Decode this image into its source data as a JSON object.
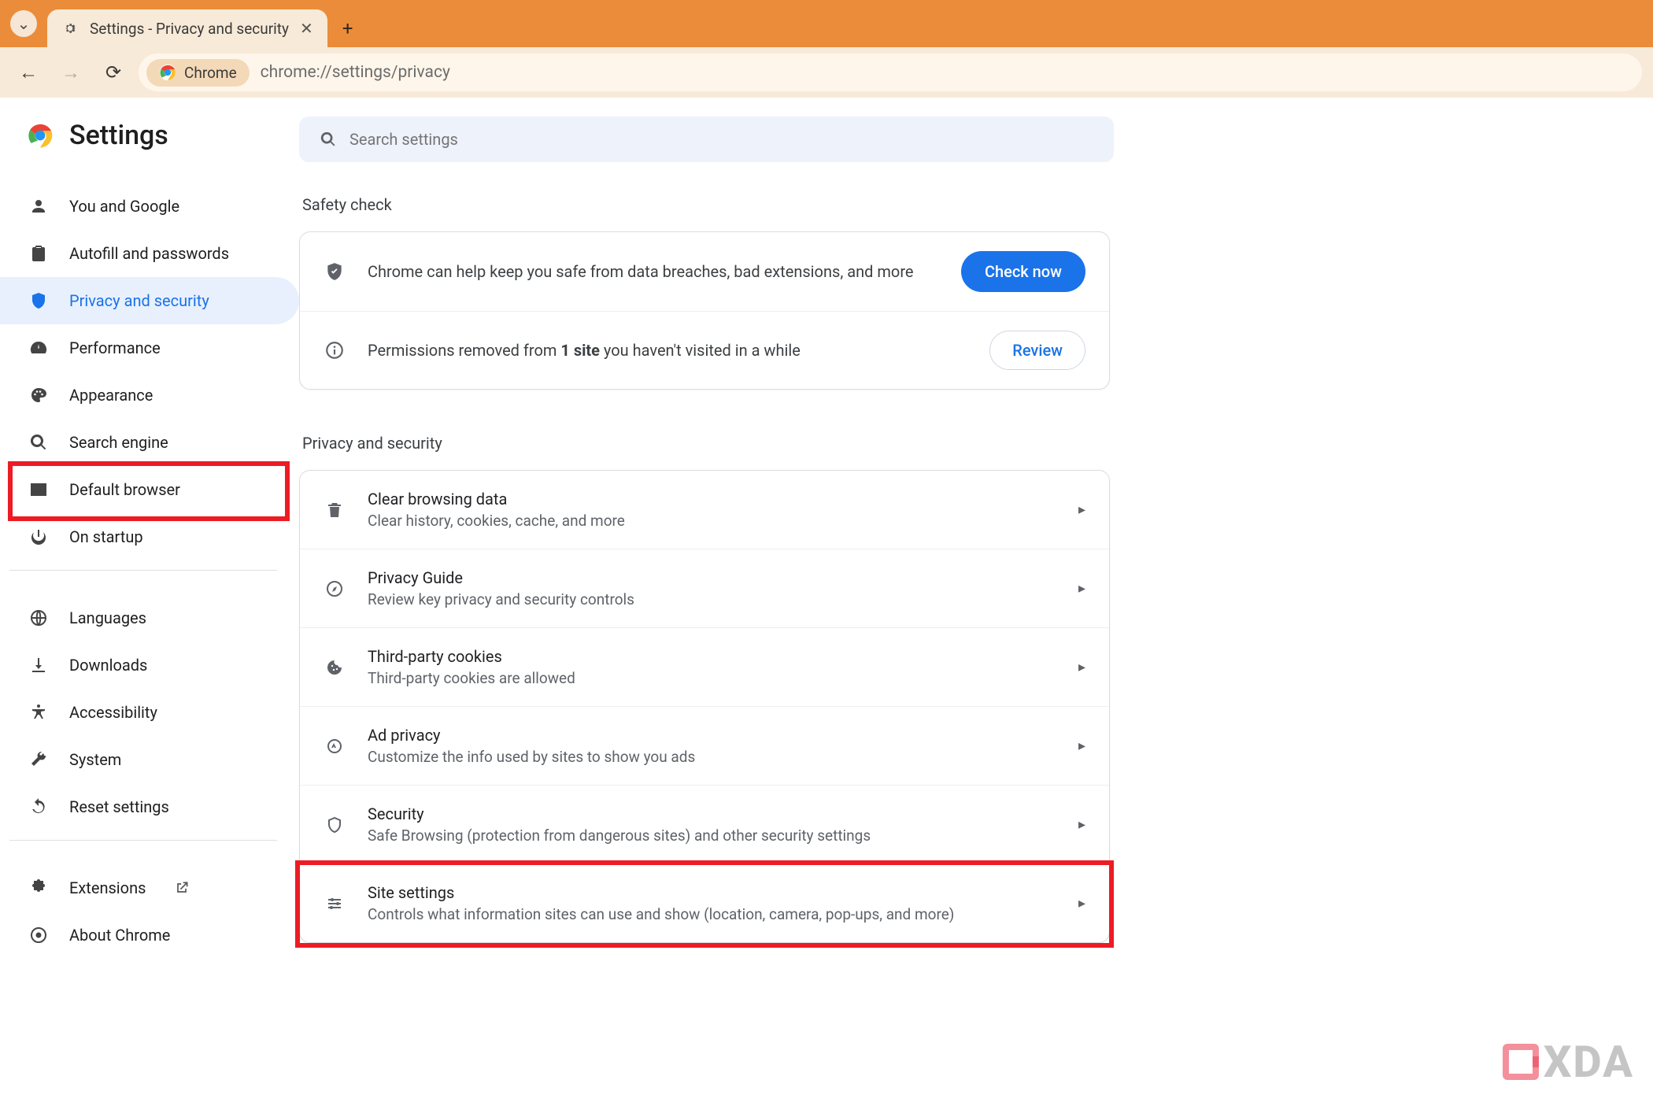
{
  "browser": {
    "tab_title": "Settings - Privacy and security",
    "omnibox_chip": "Chrome",
    "url": "chrome://settings/privacy"
  },
  "header": {
    "title": "Settings",
    "search_placeholder": "Search settings"
  },
  "sidebar": {
    "items": [
      {
        "label": "You and Google",
        "icon": "person"
      },
      {
        "label": "Autofill and passwords",
        "icon": "clipboard"
      },
      {
        "label": "Privacy and security",
        "icon": "shield",
        "active": true
      },
      {
        "label": "Performance",
        "icon": "speed"
      },
      {
        "label": "Appearance",
        "icon": "palette"
      },
      {
        "label": "Search engine",
        "icon": "search"
      },
      {
        "label": "Default browser",
        "icon": "window"
      },
      {
        "label": "On startup",
        "icon": "power"
      }
    ],
    "items2": [
      {
        "label": "Languages",
        "icon": "globe"
      },
      {
        "label": "Downloads",
        "icon": "download"
      },
      {
        "label": "Accessibility",
        "icon": "accessibility"
      },
      {
        "label": "System",
        "icon": "wrench"
      },
      {
        "label": "Reset settings",
        "icon": "restore"
      }
    ],
    "items3": [
      {
        "label": "Extensions",
        "icon": "puzzle",
        "ext": true
      },
      {
        "label": "About Chrome",
        "icon": "chrome"
      }
    ]
  },
  "safety": {
    "heading": "Safety check",
    "row1_text": "Chrome can help keep you safe from data breaches, bad extensions, and more",
    "row1_button": "Check now",
    "row2_pre": "Permissions removed from ",
    "row2_bold": "1 site",
    "row2_post": " you haven't visited in a while",
    "row2_button": "Review"
  },
  "privacy": {
    "heading": "Privacy and security",
    "rows": [
      {
        "title": "Clear browsing data",
        "sub": "Clear history, cookies, cache, and more",
        "icon": "trash"
      },
      {
        "title": "Privacy Guide",
        "sub": "Review key privacy and security controls",
        "icon": "compass"
      },
      {
        "title": "Third-party cookies",
        "sub": "Third-party cookies are allowed",
        "icon": "cookie"
      },
      {
        "title": "Ad privacy",
        "sub": "Customize the info used by sites to show you ads",
        "icon": "ads"
      },
      {
        "title": "Security",
        "sub": "Safe Browsing (protection from dangerous sites) and other security settings",
        "icon": "shield2"
      },
      {
        "title": "Site settings",
        "sub": "Controls what information sites can use and show (location, camera, pop-ups, and more)",
        "icon": "tune",
        "highlight": true
      }
    ]
  },
  "watermark": "XDA"
}
